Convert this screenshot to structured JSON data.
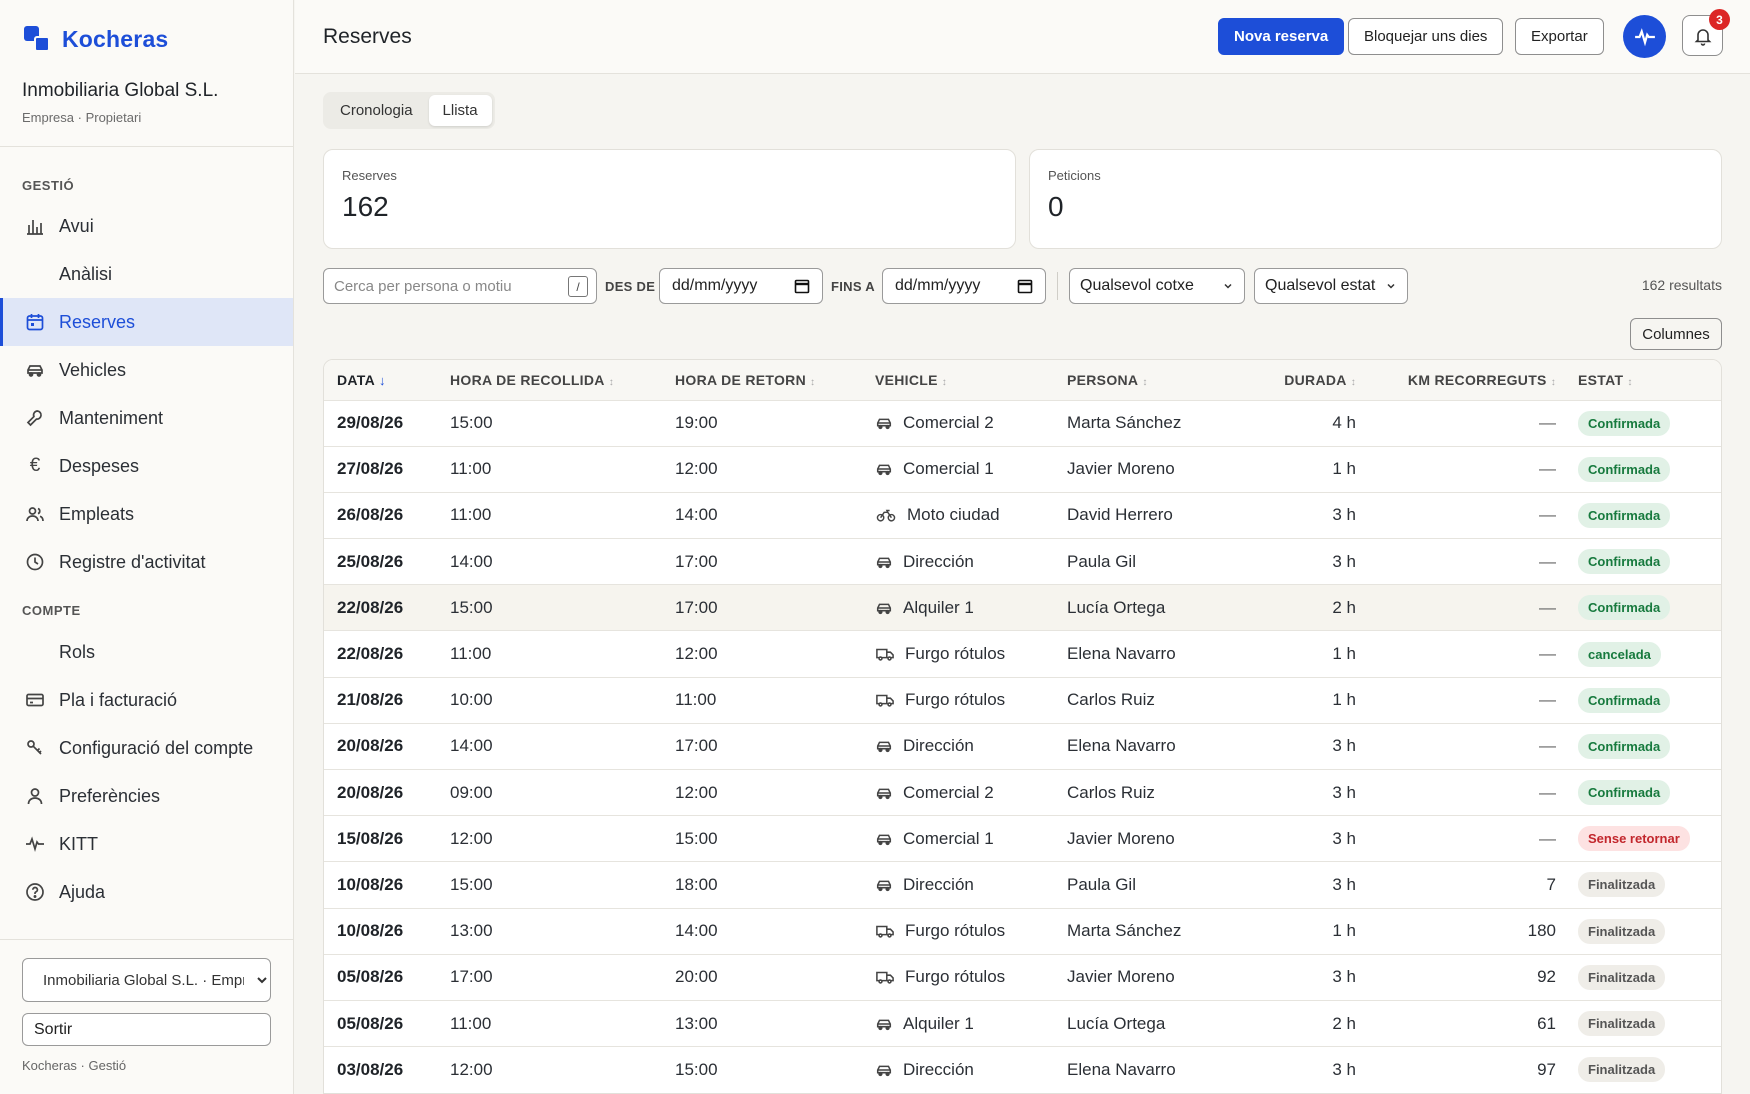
{
  "app": {
    "name": "Kocheras"
  },
  "org": {
    "name": "Inmobiliaria Global S.L.",
    "subtitle": "Empresa · Propietari"
  },
  "sidebar": {
    "section_manage": "GESTIÓ",
    "section_account": "COMPTE",
    "items": [
      {
        "label": "Avui",
        "icon": "bar-chart-icon"
      },
      {
        "label": "Anàlisi",
        "icon": ""
      },
      {
        "label": "Reserves",
        "icon": "calendar-icon"
      },
      {
        "label": "Vehicles",
        "icon": "car-icon"
      },
      {
        "label": "Manteniment",
        "icon": "wrench-icon"
      },
      {
        "label": "Despeses",
        "icon": "euro-icon"
      },
      {
        "label": "Empleats",
        "icon": "users-icon"
      },
      {
        "label": "Registre d'activitat",
        "icon": "clock-icon"
      },
      {
        "label": "Rols",
        "icon": ""
      },
      {
        "label": "Pla i facturació",
        "icon": "credit-card-icon"
      },
      {
        "label": "Configuració del compte",
        "icon": "key-icon"
      },
      {
        "label": "Preferències",
        "icon": "user-icon"
      },
      {
        "label": "KITT",
        "icon": "pulse-icon"
      },
      {
        "label": "Ajuda",
        "icon": "help-icon"
      }
    ],
    "org_select": "Inmobiliaria Global S.L. · Empresa",
    "logout": "Sortir",
    "footer": "Kocheras · Gestió"
  },
  "header": {
    "title": "Reserves",
    "new_booking": "Nova reserva",
    "block_days": "Bloquejar uns dies",
    "export": "Exportar",
    "notifications_count": "3"
  },
  "tabs": [
    {
      "label": "Cronologia",
      "active": false
    },
    {
      "label": "Llista",
      "active": true
    }
  ],
  "stats": {
    "bookings_label": "Reserves",
    "bookings_value": "162",
    "requests_label": "Peticions",
    "requests_value": "0"
  },
  "filters": {
    "search_placeholder": "Cerca per persona o motiu",
    "search_shortcut": "/",
    "from_label": "DES DE",
    "to_label": "FINS A",
    "date_placeholder": "dd/mm/yyyy",
    "car_select": "Qualsevol cotxe",
    "status_select": "Qualsevol estat",
    "results": "162 resultats",
    "columns_button": "Columnes"
  },
  "table": {
    "columns": [
      "DATA",
      "HORA DE RECOLLIDA",
      "HORA DE RETORN",
      "VEHICLE",
      "PERSONA",
      "DURADA",
      "KM RECORREGUTS",
      "ESTAT"
    ],
    "rows": [
      {
        "date": "29/08/26",
        "pickup": "15:00",
        "return": "19:00",
        "vehicle": "Comercial 2",
        "vtype": "car",
        "person": "Marta Sánchez",
        "duration": "4 h",
        "km": "—",
        "status": "Confirmada",
        "stype": "ok"
      },
      {
        "date": "27/08/26",
        "pickup": "11:00",
        "return": "12:00",
        "vehicle": "Comercial 1",
        "vtype": "car",
        "person": "Javier Moreno",
        "duration": "1 h",
        "km": "—",
        "status": "Confirmada",
        "stype": "ok"
      },
      {
        "date": "26/08/26",
        "pickup": "11:00",
        "return": "14:00",
        "vehicle": "Moto ciudad",
        "vtype": "moto",
        "person": "David Herrero",
        "duration": "3 h",
        "km": "—",
        "status": "Confirmada",
        "stype": "ok"
      },
      {
        "date": "25/08/26",
        "pickup": "14:00",
        "return": "17:00",
        "vehicle": "Dirección",
        "vtype": "car",
        "person": "Paula Gil",
        "duration": "3 h",
        "km": "—",
        "status": "Confirmada",
        "stype": "ok"
      },
      {
        "date": "22/08/26",
        "pickup": "15:00",
        "return": "17:00",
        "vehicle": "Alquiler 1",
        "vtype": "car",
        "person": "Lucía Ortega",
        "duration": "2 h",
        "km": "—",
        "status": "Confirmada",
        "stype": "ok"
      },
      {
        "date": "22/08/26",
        "pickup": "11:00",
        "return": "12:00",
        "vehicle": "Furgo rótulos",
        "vtype": "van",
        "person": "Elena Navarro",
        "duration": "1 h",
        "km": "—",
        "status": "cancelada",
        "stype": "cancel"
      },
      {
        "date": "21/08/26",
        "pickup": "10:00",
        "return": "11:00",
        "vehicle": "Furgo rótulos",
        "vtype": "van",
        "person": "Carlos Ruiz",
        "duration": "1 h",
        "km": "—",
        "status": "Confirmada",
        "stype": "ok"
      },
      {
        "date": "20/08/26",
        "pickup": "14:00",
        "return": "17:00",
        "vehicle": "Dirección",
        "vtype": "car",
        "person": "Elena Navarro",
        "duration": "3 h",
        "km": "—",
        "status": "Confirmada",
        "stype": "ok"
      },
      {
        "date": "20/08/26",
        "pickup": "09:00",
        "return": "12:00",
        "vehicle": "Comercial 2",
        "vtype": "car",
        "person": "Carlos Ruiz",
        "duration": "3 h",
        "km": "—",
        "status": "Confirmada",
        "stype": "ok"
      },
      {
        "date": "15/08/26",
        "pickup": "12:00",
        "return": "15:00",
        "vehicle": "Comercial 1",
        "vtype": "car",
        "person": "Javier Moreno",
        "duration": "3 h",
        "km": "—",
        "status": "Sense retornar",
        "stype": "warn"
      },
      {
        "date": "10/08/26",
        "pickup": "15:00",
        "return": "18:00",
        "vehicle": "Dirección",
        "vtype": "car",
        "person": "Paula Gil",
        "duration": "3 h",
        "km": "7",
        "status": "Finalitzada",
        "stype": "done"
      },
      {
        "date": "10/08/26",
        "pickup": "13:00",
        "return": "14:00",
        "vehicle": "Furgo rótulos",
        "vtype": "van",
        "person": "Marta Sánchez",
        "duration": "1 h",
        "km": "180",
        "status": "Finalitzada",
        "stype": "done"
      },
      {
        "date": "05/08/26",
        "pickup": "17:00",
        "return": "20:00",
        "vehicle": "Furgo rótulos",
        "vtype": "van",
        "person": "Javier Moreno",
        "duration": "3 h",
        "km": "92",
        "status": "Finalitzada",
        "stype": "done"
      },
      {
        "date": "05/08/26",
        "pickup": "11:00",
        "return": "13:00",
        "vehicle": "Alquiler 1",
        "vtype": "car",
        "person": "Lucía Ortega",
        "duration": "2 h",
        "km": "61",
        "status": "Finalitzada",
        "stype": "done"
      },
      {
        "date": "03/08/26",
        "pickup": "12:00",
        "return": "15:00",
        "vehicle": "Dirección",
        "vtype": "car",
        "person": "Elena Navarro",
        "duration": "3 h",
        "km": "97",
        "status": "Finalitzada",
        "stype": "done"
      }
    ]
  },
  "colors": {
    "accent": "#1d4ed8",
    "success": "#177a3e",
    "danger": "#c2272d"
  }
}
